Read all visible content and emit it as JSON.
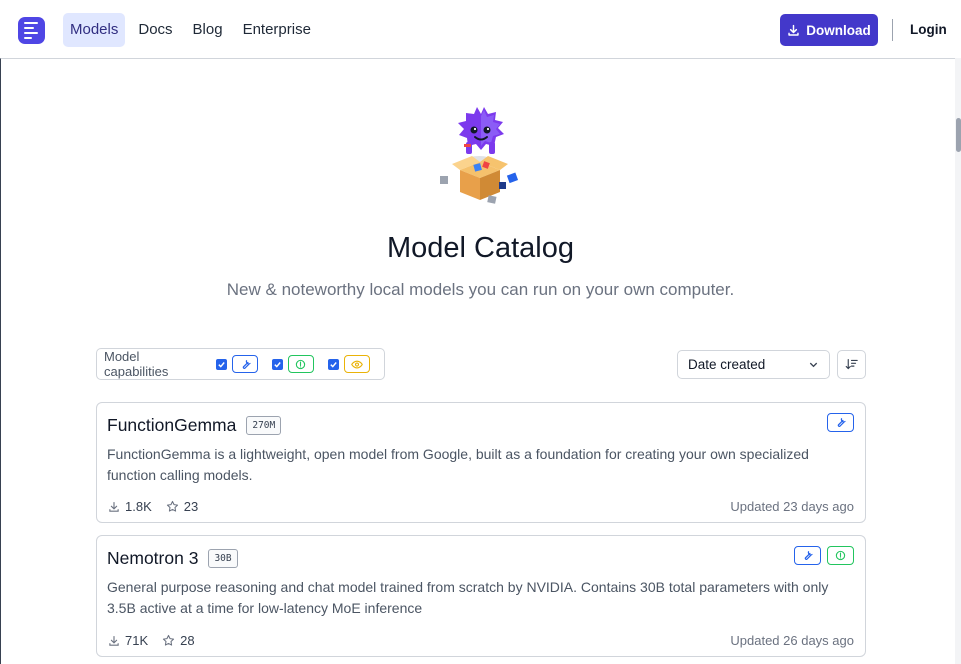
{
  "nav": {
    "items": [
      {
        "label": "Models",
        "active": true
      },
      {
        "label": "Docs",
        "active": false
      },
      {
        "label": "Blog",
        "active": false
      },
      {
        "label": "Enterprise",
        "active": false
      }
    ],
    "download_label": "Download",
    "login_label": "Login"
  },
  "hero": {
    "title": "Model Catalog",
    "subtitle": "New & noteworthy local models you can run on your own computer."
  },
  "filters": {
    "capabilities_label": "Model capabilities",
    "capabilities": [
      {
        "icon": "wrench-icon",
        "checked": true,
        "color": "#2563eb"
      },
      {
        "icon": "lightbulb-icon",
        "checked": true,
        "color": "#22c55e"
      },
      {
        "icon": "eye-icon",
        "checked": true,
        "color": "#eab308"
      }
    ],
    "sort_value": "Date created"
  },
  "models": [
    {
      "name": "FunctionGemma",
      "size": "270M",
      "description": "FunctionGemma is a lightweight, open model from Google, built as a foundation for creating your own specialized function calling models.",
      "downloads": "1.8K",
      "stars": "23",
      "updated": "Updated 23 days ago",
      "capabilities": [
        "wrench-icon"
      ]
    },
    {
      "name": "Nemotron 3",
      "size": "30B",
      "description": "General purpose reasoning and chat model trained from scratch by NVIDIA. Contains 30B total parameters with only 3.5B active at a time for low-latency MoE inference",
      "downloads": "71K",
      "stars": "28",
      "updated": "Updated 26 days ago",
      "capabilities": [
        "wrench-icon",
        "lightbulb-icon"
      ]
    }
  ],
  "colors": {
    "accent": "#4338ca",
    "nav_active_bg": "#e0e7ff",
    "tool": "#2563eb",
    "reasoning": "#22c55e",
    "vision": "#eab308"
  }
}
